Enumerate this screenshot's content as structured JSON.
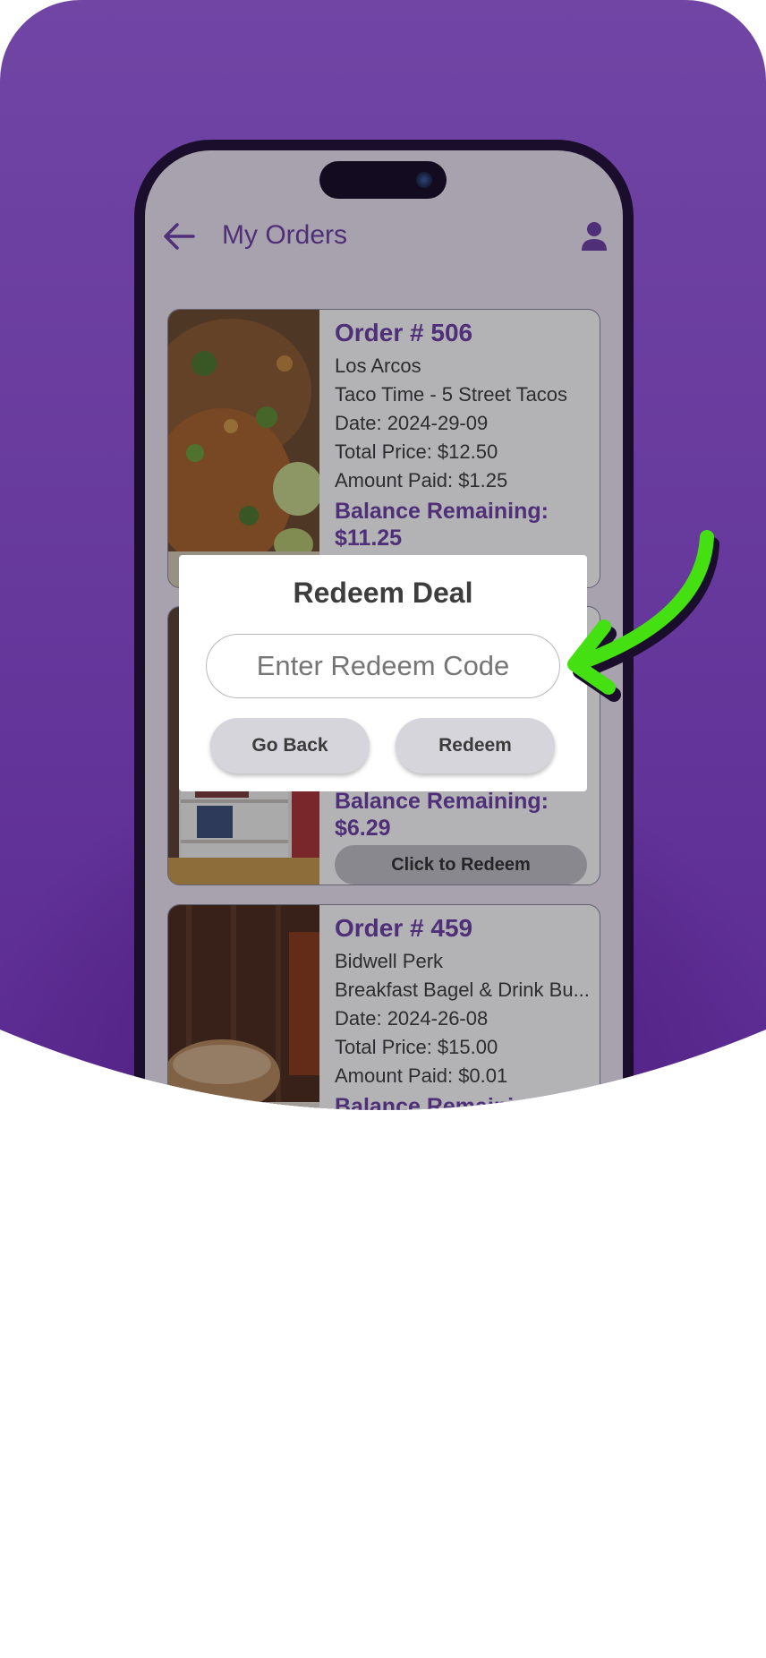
{
  "app": {
    "title": "My Orders"
  },
  "orders": [
    {
      "number": "Order # 506",
      "store": "Los Arcos",
      "item": "Taco Time - 5 Street Tacos",
      "date": "Date: 2024-29-09",
      "total": "Total Price: $12.50",
      "paid": "Amount Paid: $1.25",
      "balance_label": "Balance Remaining:",
      "balance_value": "$11.25"
    },
    {
      "balance_label": "Balance Remaining:",
      "balance_value": "$6.29",
      "redeem_label": "Click to Redeem"
    },
    {
      "number": "Order # 459",
      "store": "Bidwell Perk",
      "item": "Breakfast Bagel & Drink Bu...",
      "date": "Date: 2024-26-08",
      "total": "Total Price: $15.00",
      "paid": "Amount Paid: $0.01",
      "balance_label": "Balance Remaining:"
    }
  ],
  "dialog": {
    "title": "Redeem Deal",
    "input_placeholder": "Enter Redeem Code",
    "go_back_label": "Go Back",
    "redeem_label": "Redeem"
  },
  "colors": {
    "brand_purple": "#6a3ea5",
    "background_purple": "#66389c",
    "arrow_green": "#44e011"
  },
  "icons": [
    "back-arrow-icon",
    "user-icon",
    "callout-arrow-icon"
  ]
}
